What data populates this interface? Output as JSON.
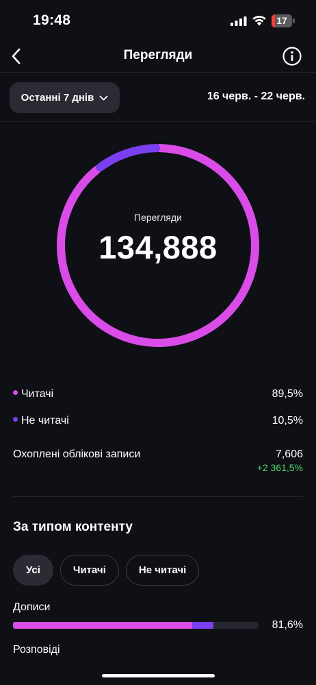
{
  "status_bar": {
    "time": "19:48",
    "battery_level": "17"
  },
  "header": {
    "title": "Перегляди"
  },
  "filter": {
    "period_label": "Останні 7 днів",
    "date_range": "16 черв. - 22 черв."
  },
  "summary": {
    "label": "Перегляди",
    "total": "134,888"
  },
  "legend": {
    "followers_label": "Читачі",
    "followers_value": "89,5%",
    "non_followers_label": "Не читачі",
    "non_followers_value": "10,5%",
    "accounts_label": "Охоплені облікові записи",
    "accounts_value": "7,606",
    "accounts_delta": "+2 361,5%"
  },
  "content_type": {
    "title": "За типом контенту",
    "tabs": [
      {
        "label": "Усі"
      },
      {
        "label": "Читачі"
      },
      {
        "label": "Не читачі"
      }
    ],
    "posts_label": "Дописи",
    "posts_value": "81,6%",
    "stories_label": "Розповіді"
  },
  "colors": {
    "followers": "#d94ce8",
    "non_followers": "#7a3ff0",
    "positive": "#4cd964"
  },
  "chart_data": {
    "type": "pie",
    "categories": [
      "Читачі",
      "Не читачі"
    ],
    "values": [
      89.5,
      10.5
    ]
  }
}
